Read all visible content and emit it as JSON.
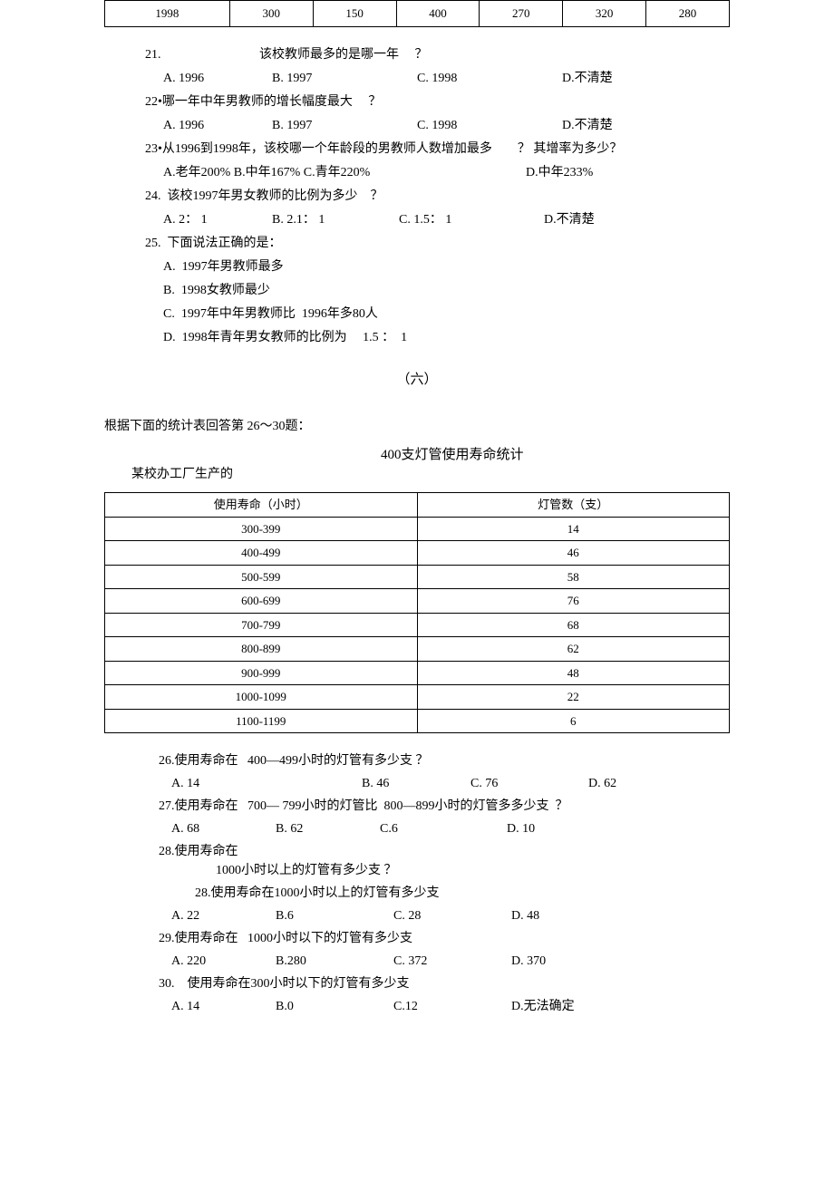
{
  "top_table": {
    "row": [
      "1998",
      "300",
      "150",
      "400",
      "270",
      "320",
      "280"
    ]
  },
  "q21": {
    "num": "21.",
    "text": "该校教师最多的是哪一年",
    "qmark": "？",
    "opts": {
      "a": "A. 1996",
      "b": "B. 1997",
      "c": "C. 1998",
      "d": "D.不清楚"
    }
  },
  "q22": {
    "line": "22•哪一年中年男教师的增长幅度最大",
    "qmark": "？",
    "opts": {
      "a": "A. 1996",
      "b": "B. 1997",
      "c": "C. 1998",
      "d": "D.不清楚"
    }
  },
  "q23": {
    "line": "23•从1996到1998年，该校哪一个年龄段的男教师人数增加最多",
    "qmark": "？",
    "tail": "其增率为多少？",
    "opts": {
      "abc": "A.老年200% B.中年167% C.青年220%",
      "d": "D.中年233%"
    }
  },
  "q24": {
    "line": "24.  该校1997年男女教师的比例为多少",
    "qmark": "？",
    "opts": {
      "a": "A. 2： 1",
      "b": "B. 2.1： 1",
      "c": "C. 1.5： 1",
      "d": "D.不清楚"
    }
  },
  "q25": {
    "line": "25.  下面说法正确的是：",
    "a": "A.  1997年男教师最多",
    "b": "B.  1998女教师最少",
    "c": "C.  1997年中年男教师比  1996年多80人",
    "d": "D.  1998年青年男女教师的比例为     1.5 ：  1"
  },
  "section6": "（六）",
  "instr": "根据下面的统计表回答第  26～30题：",
  "t2title1": "某校办工厂生产的",
  "t2title2": "400支灯管使用寿命统计",
  "chart_data": {
    "type": "table",
    "headers": [
      "使用寿命（小时）",
      "灯管数（支）"
    ],
    "rows": [
      [
        "300-399",
        "14"
      ],
      [
        "400-499",
        "46"
      ],
      [
        "500-599",
        "58"
      ],
      [
        "600-699",
        "76"
      ],
      [
        "700-799",
        "68"
      ],
      [
        "800-899",
        "62"
      ],
      [
        "900-999",
        "48"
      ],
      [
        "1000-1099",
        "22"
      ],
      [
        "1100-1199",
        "6"
      ]
    ]
  },
  "q26": {
    "pre": "26.使用寿命在",
    "mid": "400—499小时的灯管有多少支 ？",
    "opts": {
      "a": "A. 14",
      "b": "B. 46",
      "c": "C. 76",
      "d": "D. 62"
    }
  },
  "q27": {
    "pre": "27.使用寿命在",
    "mid": "700— 799小时的灯管比  800—899小时的灯管多多少支  ？",
    "opts": {
      "a": "A. 68",
      "b": "B. 62",
      "c": "C.6",
      "d": "D. 10"
    }
  },
  "q28": {
    "pre": "28.使用寿命在",
    "mid": "1000小时以上的灯管有多少支 ？",
    "sub": "28.使用寿命在1000小时以上的灯管有多少支",
    "opts": {
      "a": "A. 22",
      "b": "B.6",
      "c": "C. 28",
      "d": "D. 48"
    }
  },
  "q29": {
    "pre": "29.使用寿命在",
    "mid": "1000小时以下的灯管有多少支",
    "opts": {
      "a": "A. 220",
      "b": "B.280",
      "c": "C. 372",
      "d": "D. 370"
    }
  },
  "q30": {
    "line": "30.    使用寿命在300小时以下的灯管有多少支",
    "opts": {
      "a": "A. 14",
      "b": "B.0",
      "c": "C.12",
      "d": "D.无法确定"
    }
  }
}
